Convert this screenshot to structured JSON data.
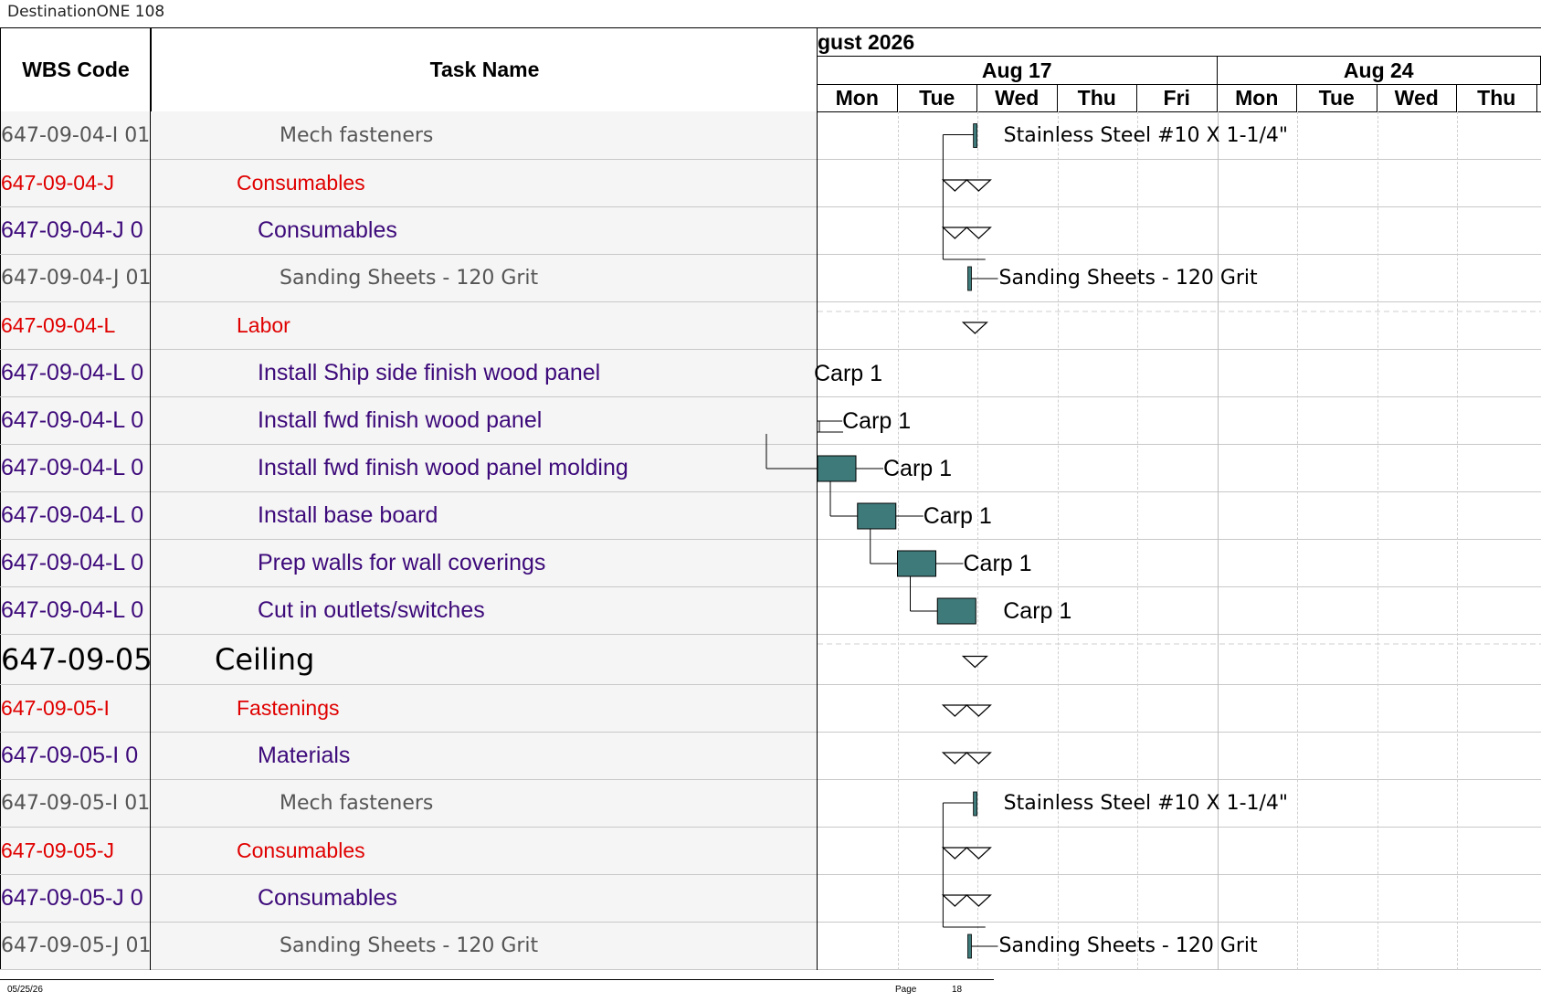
{
  "document": {
    "title": "DestinationONE 108"
  },
  "columns": {
    "wbs": "WBS Code",
    "task": "Task Name"
  },
  "timescale": {
    "month": "gust 2026",
    "weeks": [
      "Aug 17",
      "Aug 24"
    ],
    "days": [
      "Mon",
      "Tue",
      "Wed",
      "Thu",
      "Fri",
      "Mon",
      "Tue",
      "Wed",
      "Thu"
    ]
  },
  "rows": [
    {
      "wbs": "647-09-04-I 01",
      "task": "Mech fasteners",
      "style": "gray",
      "indent": 3,
      "gantt": {
        "type": "milestone-bar",
        "label": "Stainless Steel #10 X 1-1/4\""
      }
    },
    {
      "wbs": "647-09-04-J",
      "task": "Consumables",
      "style": "red",
      "indent": 1,
      "gantt": {
        "type": "summary"
      }
    },
    {
      "wbs": "647-09-04-J 0",
      "task": "Consumables",
      "style": "purple",
      "indent": 2,
      "gantt": {
        "type": "summary"
      }
    },
    {
      "wbs": "647-09-04-J 01",
      "task": "Sanding Sheets - 120 Grit",
      "style": "gray",
      "indent": 3,
      "gantt": {
        "type": "milestone-bar",
        "label": "Sanding Sheets - 120 Grit"
      }
    },
    {
      "wbs": "647-09-04-L",
      "task": "Labor",
      "style": "red",
      "indent": 1,
      "gantt": {
        "type": "summary-single"
      }
    },
    {
      "wbs": "647-09-04-L 0",
      "task": "Install Ship side finish wood panel",
      "style": "purple",
      "indent": 2,
      "gantt": {
        "type": "task",
        "label": "Carp 1"
      }
    },
    {
      "wbs": "647-09-04-L 0",
      "task": "Install fwd finish wood panel",
      "style": "purple",
      "indent": 2,
      "gantt": {
        "type": "task",
        "label": "Carp 1"
      }
    },
    {
      "wbs": "647-09-04-L 0",
      "task": "Install fwd finish wood panel molding",
      "style": "purple",
      "indent": 2,
      "gantt": {
        "type": "task",
        "label": "Carp 1"
      }
    },
    {
      "wbs": "647-09-04-L 0",
      "task": "Install base board",
      "style": "purple",
      "indent": 2,
      "gantt": {
        "type": "task",
        "label": "Carp 1"
      }
    },
    {
      "wbs": "647-09-04-L 0",
      "task": "Prep walls for wall coverings",
      "style": "purple",
      "indent": 2,
      "gantt": {
        "type": "task",
        "label": "Carp 1"
      }
    },
    {
      "wbs": "647-09-04-L 0",
      "task": "Cut in outlets/switches",
      "style": "purple",
      "indent": 2,
      "gantt": {
        "type": "task",
        "label": "Carp 1"
      }
    },
    {
      "wbs": "647-09-05",
      "task": "Ceiling",
      "style": "black",
      "indent": 0,
      "gantt": {
        "type": "summary-single"
      }
    },
    {
      "wbs": "647-09-05-I",
      "task": "Fastenings",
      "style": "red",
      "indent": 1,
      "gantt": {
        "type": "summary"
      }
    },
    {
      "wbs": "647-09-05-I 0",
      "task": "Materials",
      "style": "purple",
      "indent": 2,
      "gantt": {
        "type": "summary"
      }
    },
    {
      "wbs": "647-09-05-I 01",
      "task": "Mech fasteners",
      "style": "gray",
      "indent": 3,
      "gantt": {
        "type": "milestone-bar",
        "label": "Stainless Steel #10 X 1-1/4\""
      }
    },
    {
      "wbs": "647-09-05-J",
      "task": "Consumables",
      "style": "red",
      "indent": 1,
      "gantt": {
        "type": "summary"
      }
    },
    {
      "wbs": "647-09-05-J 0",
      "task": "Consumables",
      "style": "purple",
      "indent": 2,
      "gantt": {
        "type": "summary"
      }
    },
    {
      "wbs": "647-09-05-J 01",
      "task": "Sanding Sheets - 120 Grit",
      "style": "gray",
      "indent": 3,
      "gantt": {
        "type": "milestone-bar",
        "label": "Sanding Sheets - 120 Grit"
      }
    }
  ],
  "footer": {
    "date": "05/25/26",
    "page_label": "Page",
    "page_number": "18"
  },
  "colors": {
    "bar": "#3f7a7a",
    "red": "#e00000",
    "purple": "#3d0a7a",
    "gray": "#555555"
  }
}
